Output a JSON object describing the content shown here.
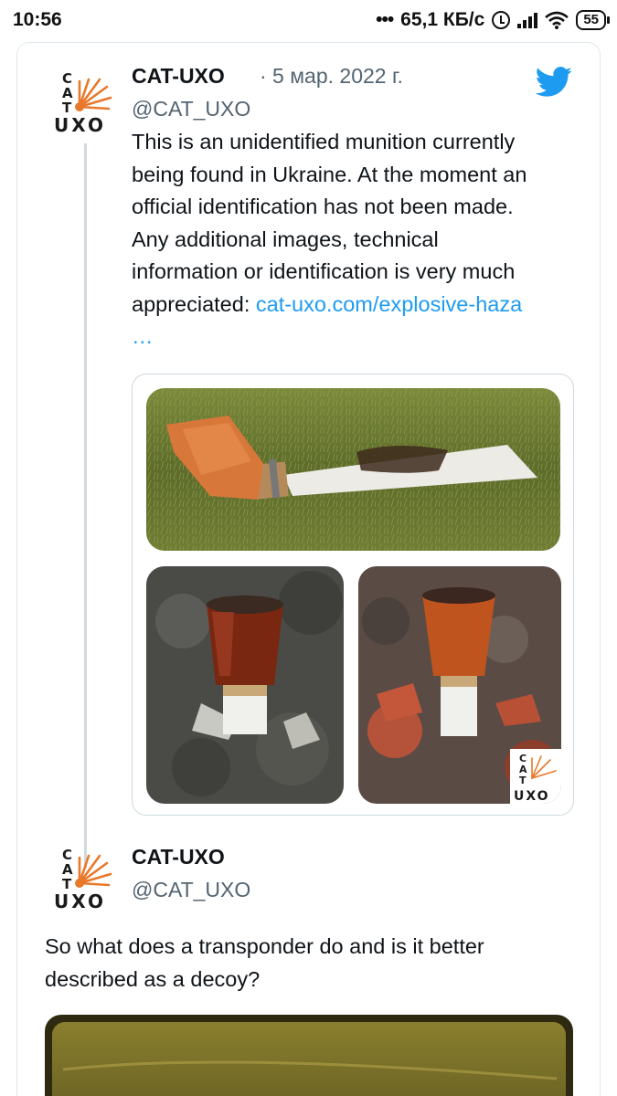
{
  "status_bar": {
    "time": "10:56",
    "net_speed": "65,1 КБ/с",
    "battery": "55"
  },
  "tweet1": {
    "author_name": "CAT-UXO",
    "date": "· 5 мар. 2022 г.",
    "handle": "@CAT_UXO",
    "text_lines": [
      "This is an unidentified munition currently",
      "being found in Ukraine. At the moment an",
      "official identification has not been made.",
      "Any additional images, technical",
      "information or identification is very much"
    ],
    "text_last_prefix": "appreciated: ",
    "link_text": "cat-uxo.com/explosive-haza",
    "link_ellipsis": "…",
    "watermark_logo": {
      "c": "C",
      "a": "A",
      "t": "T",
      "uxo": "UXO"
    }
  },
  "tweet2": {
    "author_name": "CAT-UXO",
    "handle": "@CAT_UXO",
    "text_lines": [
      "So what does a transponder do and is it better",
      "described as a decoy?"
    ]
  },
  "avatar_logo": {
    "c": "C",
    "a": "A",
    "t": "T",
    "uxo": "UXO"
  },
  "colors": {
    "link": "#1d9bf0",
    "twitter_blue": "#1d9bf0",
    "secondary_text": "#536471",
    "logo_orange": "#e8782a"
  },
  "icons": {
    "brand": "twitter-bird-icon"
  }
}
